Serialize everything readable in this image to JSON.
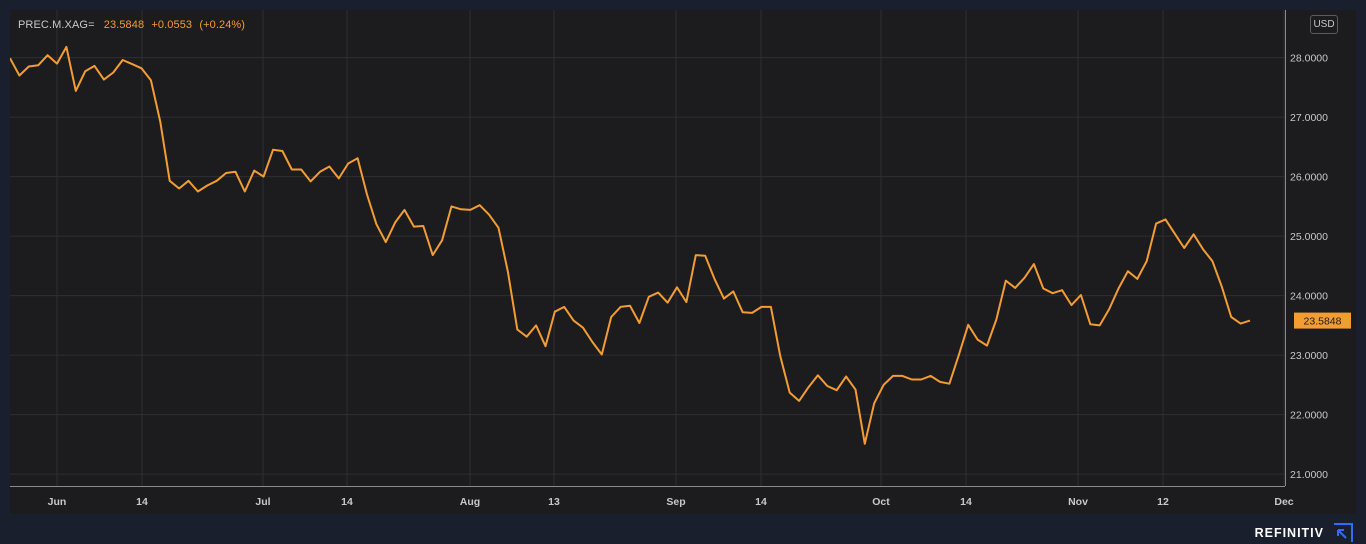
{
  "legend": {
    "symbol": "PREC.M.XAG=",
    "price": "23.5848",
    "change": "+0.0553",
    "change_pct": "(+0.24%)"
  },
  "currency": "USD",
  "brand": "REFINITIV",
  "colors": {
    "line": "#f39c32",
    "background": "#1c1c1f",
    "frame": "#1a1f2e",
    "grid": "#2e2e33",
    "text": "#c8c8c8",
    "brand_icon": "#2f6bff"
  },
  "chart_data": {
    "type": "line",
    "x_tick_labels": [
      "Jun",
      "14",
      "Jul",
      "14",
      "Aug",
      "13",
      "Sep",
      "14",
      "Oct",
      "14",
      "Nov",
      "12",
      "Dec"
    ],
    "y_tick_labels": [
      "28.0000",
      "27.0000",
      "26.0000",
      "25.0000",
      "24.0000",
      "23.0000",
      "22.0000",
      "21.0000"
    ],
    "ylim": [
      20.8,
      28.8
    ],
    "last_value_label": "23.5848",
    "grid": true,
    "series": [
      {
        "values": [
          27.99,
          27.7,
          27.85,
          27.87,
          28.04,
          27.9,
          28.18,
          27.44,
          27.77,
          27.86,
          27.63,
          27.75,
          27.96,
          27.89,
          27.82,
          27.62,
          26.92,
          25.93,
          25.8,
          25.93,
          25.75,
          25.85,
          25.93,
          26.06,
          26.08,
          25.75,
          26.1,
          26.0,
          26.45,
          26.43,
          26.12,
          26.12,
          25.92,
          26.08,
          26.17,
          25.97,
          26.22,
          26.31,
          25.7,
          25.2,
          24.9,
          25.23,
          25.44,
          25.16,
          25.17,
          24.68,
          24.93,
          25.5,
          25.45,
          25.44,
          25.52,
          25.36,
          25.14,
          24.4,
          23.43,
          23.31,
          23.5,
          23.15,
          23.73,
          23.81,
          23.58,
          23.46,
          23.22,
          23.01,
          23.64,
          23.81,
          23.83,
          23.54,
          23.98,
          24.05,
          23.88,
          24.14,
          23.89,
          24.68,
          24.67,
          24.28,
          23.95,
          24.07,
          23.72,
          23.71,
          23.81,
          23.81,
          22.98,
          22.37,
          22.23,
          22.46,
          22.66,
          22.48,
          22.41,
          22.64,
          22.42,
          21.51,
          22.19,
          22.5,
          22.65,
          22.65,
          22.59,
          22.59,
          22.65,
          22.55,
          22.52,
          23.0,
          23.51,
          23.26,
          23.16,
          23.6,
          24.25,
          24.13,
          24.3,
          24.53,
          24.12,
          24.04,
          24.09,
          23.84,
          24.01,
          23.52,
          23.5,
          23.77,
          24.12,
          24.41,
          24.28,
          24.58,
          25.21,
          25.28,
          25.04,
          24.8,
          25.03,
          24.78,
          24.58,
          24.15,
          23.64,
          23.53,
          23.58
        ]
      }
    ]
  }
}
